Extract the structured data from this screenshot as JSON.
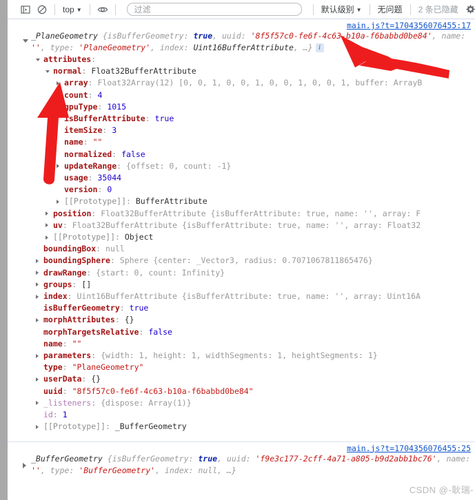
{
  "toolbar": {
    "icons": {
      "sidebar": "sidebar-panel-icon",
      "clear": "clear-console-icon",
      "eye": "live-expression-eye-icon",
      "gear": "settings-gear-icon"
    },
    "context_selector": "top",
    "filter_placeholder": "过滤",
    "filter_value": "",
    "level_selector": "默认级别",
    "issues_label": "无问题",
    "hidden_label": "2 条已隐藏"
  },
  "entries": [
    {
      "source_link": "main.js?t=1704356076455:17",
      "preview": {
        "class": "_PlaneGeometry",
        "open_brace": "{",
        "parts": [
          {
            "k": "isBufferGeometry",
            "v": "true",
            "t": "bool"
          },
          {
            "k": "uuid",
            "v": "'8f5f57c0-fe6f-4c63-b10a-f6babbd0be84'",
            "t": "str"
          },
          {
            "k": "name",
            "v": "''",
            "t": "str"
          },
          {
            "k": "type",
            "v": "'PlaneGeometry'",
            "t": "str"
          },
          {
            "k": "index",
            "v": "Uint16BufferAttribute",
            "t": "cls"
          }
        ],
        "tail": ", …}",
        "info_badge": "i"
      },
      "rows": [
        {
          "indent": 1,
          "tw": "open",
          "key": "attributes",
          "kt": "own",
          "sep": ":",
          "val": "",
          "vt": ""
        },
        {
          "indent": 2,
          "tw": "open",
          "key": "normal",
          "kt": "own",
          "sep": ":",
          "val": "Float32BufferAttribute",
          "vt": "dark"
        },
        {
          "indent": 3,
          "tw": "closed",
          "key": "array",
          "kt": "own",
          "sep": ":",
          "val": "Float32Array(12) [0, 0, 1, 0, 0, 1, 0, 0, 1, 0, 0, 1, buffer: ArrayB",
          "vt": "mixed-array"
        },
        {
          "indent": 3,
          "tw": "",
          "key": "count",
          "kt": "own",
          "sep": ":",
          "val": "4",
          "vt": "num"
        },
        {
          "indent": 3,
          "tw": "",
          "key": "gpuType",
          "kt": "own",
          "sep": ":",
          "val": "1015",
          "vt": "num"
        },
        {
          "indent": 3,
          "tw": "",
          "key": "isBufferAttribute",
          "kt": "own",
          "sep": ":",
          "val": "true",
          "vt": "bool"
        },
        {
          "indent": 3,
          "tw": "",
          "key": "itemSize",
          "kt": "own",
          "sep": ":",
          "val": "3",
          "vt": "num"
        },
        {
          "indent": 3,
          "tw": "",
          "key": "name",
          "kt": "own",
          "sep": ":",
          "val": "\"\"",
          "vt": "str"
        },
        {
          "indent": 3,
          "tw": "",
          "key": "normalized",
          "kt": "own",
          "sep": ":",
          "val": "false",
          "vt": "bool"
        },
        {
          "indent": 3,
          "tw": "closed",
          "key": "updateRange",
          "kt": "own",
          "sep": ":",
          "val": "{offset: 0, count: -1}",
          "vt": "obj-lit"
        },
        {
          "indent": 3,
          "tw": "",
          "key": "usage",
          "kt": "own",
          "sep": ":",
          "val": "35044",
          "vt": "num"
        },
        {
          "indent": 3,
          "tw": "",
          "key": "version",
          "kt": "own",
          "sep": ":",
          "val": "0",
          "vt": "num"
        },
        {
          "indent": 3,
          "tw": "closed",
          "key": "[[Prototype]]",
          "kt": "proto",
          "sep": ":",
          "val": "BufferAttribute",
          "vt": "dark"
        },
        {
          "indent": 2,
          "tw": "closed",
          "key": "position",
          "kt": "own",
          "sep": ":",
          "val": "Float32BufferAttribute {isBufferAttribute: true, name: '', array: F",
          "vt": "preview-obj"
        },
        {
          "indent": 2,
          "tw": "closed",
          "key": "uv",
          "kt": "own",
          "sep": ":",
          "val": "Float32BufferAttribute {isBufferAttribute: true, name: '', array: Float32",
          "vt": "preview-obj"
        },
        {
          "indent": 2,
          "tw": "closed",
          "key": "[[Prototype]]",
          "kt": "proto",
          "sep": ":",
          "val": "Object",
          "vt": "dark"
        },
        {
          "indent": 1,
          "tw": "",
          "key": "boundingBox",
          "kt": "own",
          "sep": ":",
          "val": "null",
          "vt": "null"
        },
        {
          "indent": 1,
          "tw": "closed",
          "key": "boundingSphere",
          "kt": "own",
          "sep": ":",
          "val": "Sphere {center: _Vector3, radius: 0.7071067811865476}",
          "vt": "sphere"
        },
        {
          "indent": 1,
          "tw": "closed",
          "key": "drawRange",
          "kt": "own",
          "sep": ":",
          "val": "{start: 0, count: Infinity}",
          "vt": "drawrange"
        },
        {
          "indent": 1,
          "tw": "closed",
          "key": "groups",
          "kt": "own",
          "sep": ":",
          "val": "[]",
          "vt": "dark"
        },
        {
          "indent": 1,
          "tw": "closed",
          "key": "index",
          "kt": "own",
          "sep": ":",
          "val": "Uint16BufferAttribute {isBufferAttribute: true, name: '', array: Uint16A",
          "vt": "preview-obj2"
        },
        {
          "indent": 1,
          "tw": "",
          "key": "isBufferGeometry",
          "kt": "own",
          "sep": ":",
          "val": "true",
          "vt": "bool"
        },
        {
          "indent": 1,
          "tw": "closed",
          "key": "morphAttributes",
          "kt": "own",
          "sep": ":",
          "val": "{}",
          "vt": "dark"
        },
        {
          "indent": 1,
          "tw": "",
          "key": "morphTargetsRelative",
          "kt": "own",
          "sep": ":",
          "val": "false",
          "vt": "bool"
        },
        {
          "indent": 1,
          "tw": "",
          "key": "name",
          "kt": "own",
          "sep": ":",
          "val": "\"\"",
          "vt": "str"
        },
        {
          "indent": 1,
          "tw": "closed",
          "key": "parameters",
          "kt": "own",
          "sep": ":",
          "val": "{width: 1, height: 1, widthSegments: 1, heightSegments: 1}",
          "vt": "params"
        },
        {
          "indent": 1,
          "tw": "",
          "key": "type",
          "kt": "own",
          "sep": ":",
          "val": "\"PlaneGeometry\"",
          "vt": "str"
        },
        {
          "indent": 1,
          "tw": "closed",
          "key": "userData",
          "kt": "own",
          "sep": ":",
          "val": "{}",
          "vt": "dark"
        },
        {
          "indent": 1,
          "tw": "",
          "key": "uuid",
          "kt": "own",
          "sep": ":",
          "val": "\"8f5f57c0-fe6f-4c63-b10a-f6babbd0be84\"",
          "vt": "str"
        },
        {
          "indent": 1,
          "tw": "closed",
          "key": "_listeners",
          "kt": "dim",
          "sep": ":",
          "val": "{dispose: Array(1)}",
          "vt": "listeners"
        },
        {
          "indent": 1,
          "tw": "",
          "key": "id",
          "kt": "dim",
          "sep": ":",
          "val": "1",
          "vt": "num"
        },
        {
          "indent": 1,
          "tw": "closed",
          "key": "[[Prototype]]",
          "kt": "proto",
          "sep": ":",
          "val": "_BufferGeometry",
          "vt": "dark"
        }
      ]
    },
    {
      "source_link": "main.js?t=1704356076455:25",
      "preview": {
        "class": "_BufferGeometry",
        "open_brace": "{",
        "parts": [
          {
            "k": "isBufferGeometry",
            "v": "true",
            "t": "bool"
          },
          {
            "k": "uuid",
            "v": "'f9e3c177-2cff-4a71-a805-b9d2abb1bc76'",
            "t": "str"
          },
          {
            "k": "name",
            "v": "''",
            "t": "str"
          },
          {
            "k": "type",
            "v": "'BufferGeometry'",
            "t": "str"
          },
          {
            "k": "index",
            "v": "null",
            "t": "null"
          }
        ],
        "tail": ", …}",
        "info_badge": ""
      },
      "rows": []
    }
  ],
  "watermark": "CSDN @-耿瑞-",
  "colors": {
    "link": "#1155cc",
    "key": "#a31515",
    "number": "#1c00cf",
    "string": "#c41a16",
    "muted": "#9a9a9a",
    "arrow": "#ee1d1d"
  }
}
